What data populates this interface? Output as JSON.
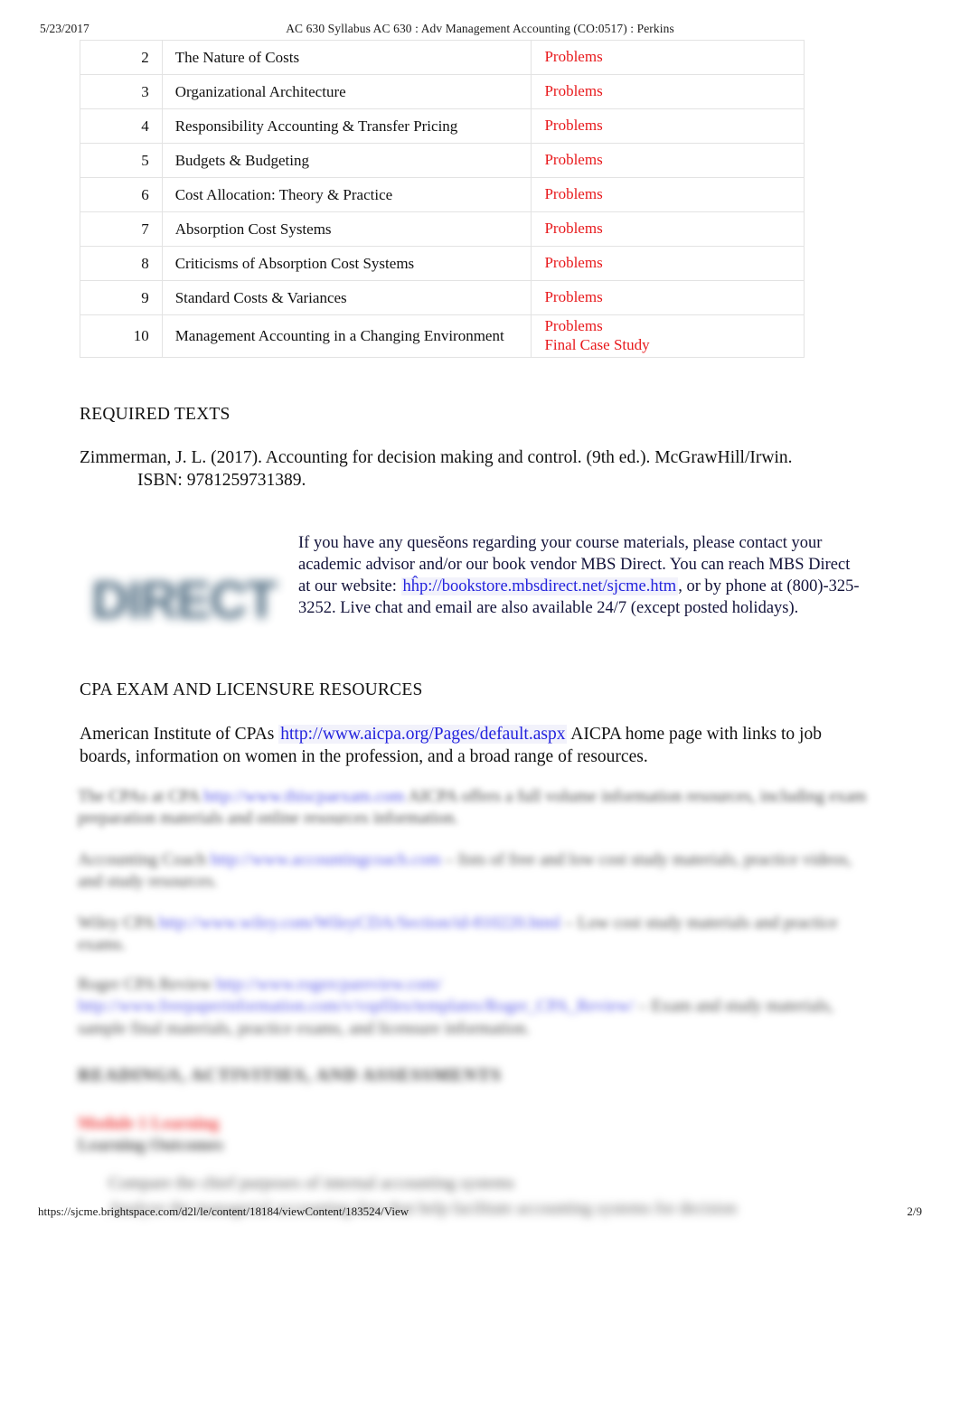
{
  "header": {
    "date": "5/23/2017",
    "title": "AC 630  Syllabus  AC 630 : Adv Management Accounting (CO:0517) : Perkins"
  },
  "schedule": {
    "rows": [
      {
        "num": "2",
        "topic": "The Nature of Costs",
        "assignment": "Problems",
        "assignment2": ""
      },
      {
        "num": "3",
        "topic": "Organizational Architecture",
        "assignment": "Problems",
        "assignment2": ""
      },
      {
        "num": "4",
        "topic": "Responsibility Accounting & Transfer Pricing",
        "assignment": "Problems",
        "assignment2": ""
      },
      {
        "num": "5",
        "topic": "Budgets & Budgeting",
        "assignment": "Problems",
        "assignment2": ""
      },
      {
        "num": "6",
        "topic": "Cost Allocation: Theory & Practice",
        "assignment": "Problems",
        "assignment2": ""
      },
      {
        "num": "7",
        "topic": "Absorption Cost Systems",
        "assignment": "Problems",
        "assignment2": ""
      },
      {
        "num": "8",
        "topic": "Criticisms of Absorption Cost Systems",
        "assignment": "Problems",
        "assignment2": ""
      },
      {
        "num": "9",
        "topic": "Standard Costs & Variances",
        "assignment": "Problems",
        "assignment2": ""
      },
      {
        "num": "10",
        "topic": "Management Accounting in a Changing Environment",
        "assignment": "Problems",
        "assignment2": "Final Case Study"
      }
    ]
  },
  "required_texts": {
    "heading": "REQUIRED TEXTS",
    "citation_line1": "Zimmerman, J. L. (2017). Accounting for decision making and control. (9th ed.). McGrawHill/Irwin.",
    "citation_line2": "ISBN: 9781259731389."
  },
  "mbs": {
    "logo_text": "DIRECT",
    "para_part1": "If you have any quesĕons regarding your course materials, please contact your academic advisor and/or our book vendor MBS Direct. You can reach MBS Direct at our website:  ",
    "link_text": "hĥp://bookstore.mbsdirect.net/sjcme.htm",
    "para_part2": ", or by phone at (800)-325-3252. Live chat and email are also available 24/7 (except posted holidays)."
  },
  "cpa": {
    "heading": "CPA EXAM AND LICENSURE RESOURCES",
    "line_prefix": "American Institute of CPAs  ",
    "link_text": "http://www.aicpa.org/Pages/default.aspx",
    "line_suffix": "  AICPA home page with links to job boards, information on women in the profession, and a broad range of resources."
  },
  "blurred": {
    "p1_prefix": "The CPAs at CPA ",
    "p1_link": "http://www.thiscpaexam.com",
    "p1_suffix": "  AICPA offers a full volume information resources, including exam preparation materials and online resources information.",
    "p2_prefix": "Accounting Coach  ",
    "p2_link": "http://www.accountingcoach.com",
    "p2_suffix": " – lists of free and low cost study materials, practice videos, and study resources.",
    "p3_prefix": "Wiley CPA  ",
    "p3_link": "http://www.wiley.com/WileyCDA/Section/id-810220.html",
    "p3_suffix": " – Low cost study materials and practice exams.",
    "p4_prefix": "Roger CPA Review  ",
    "p4_link": "http://www.rogercpareview.com/",
    "p4_link2": "http://www.freepaperinformation.com/v/vspfiles/templates/Roger_CPA_Review/",
    "p4_suffix": " – Exam and study materials, sample final materials, practice exams, and licensure information.",
    "heading": "READINGS, ACTIVITIES, AND ASSESSMENTS",
    "red_line": "Module 1 Learning",
    "sub_line": "Learning Outcomes",
    "list_item1": "Compare the chief purposes of internal accounting systems",
    "list_item2": "Analyze the managerial accounting data that help facilitate accounting systems for decision"
  },
  "footer": {
    "url": "https://sjcme.brightspace.com/d2l/le/content/18184/viewContent/183524/View",
    "page": "2/9"
  }
}
